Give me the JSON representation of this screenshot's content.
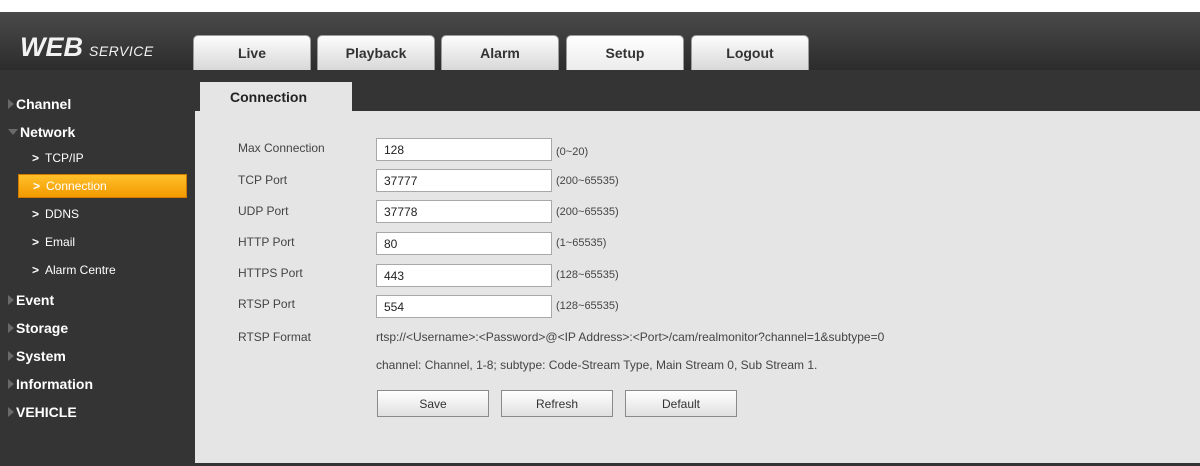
{
  "header": {
    "logo_main": "WEB",
    "logo_sub": "SERVICE",
    "tabs": [
      {
        "label": "Live"
      },
      {
        "label": "Playback"
      },
      {
        "label": "Alarm"
      },
      {
        "label": "Setup"
      },
      {
        "label": "Logout"
      }
    ],
    "active_tab": "Setup"
  },
  "sidebar": {
    "channel": "Channel",
    "network": "Network",
    "network_items": {
      "tcpip": "TCP/IP",
      "connection": "Connection",
      "ddns": "DDNS",
      "email": "Email",
      "alarm_centre": "Alarm Centre"
    },
    "active_item": "Connection",
    "event": "Event",
    "storage": "Storage",
    "system": "System",
    "information": "Information",
    "vehicle": "VEHICLE"
  },
  "main": {
    "section_tab": "Connection",
    "fields": {
      "max_connection": {
        "label": "Max Connection",
        "value": "128",
        "range": "(0~20)"
      },
      "tcp_port": {
        "label": "TCP Port",
        "value": "37777",
        "range": "(200~65535)"
      },
      "udp_port": {
        "label": "UDP Port",
        "value": "37778",
        "range": "(200~65535)"
      },
      "http_port": {
        "label": "HTTP Port",
        "value": "80",
        "range": "(1~65535)"
      },
      "https_port": {
        "label": "HTTPS Port",
        "value": "443",
        "range": "(128~65535)"
      },
      "rtsp_port": {
        "label": "RTSP Port",
        "value": "554",
        "range": "(128~65535)"
      }
    },
    "rtsp_format_label": "RTSP Format",
    "rtsp_format": "rtsp://<Username>:<Password>@<IP Address>:<Port>/cam/realmonitor?channel=1&subtype=0",
    "rtsp_note": "channel: Channel, 1-8; subtype: Code-Stream Type, Main Stream 0, Sub Stream 1.",
    "buttons": {
      "save": "Save",
      "refresh": "Refresh",
      "default": "Default"
    }
  },
  "colors": {
    "dark_bg": "#343434",
    "panel_bg": "#e5e5e5",
    "accent_orange": "#f39a00"
  }
}
